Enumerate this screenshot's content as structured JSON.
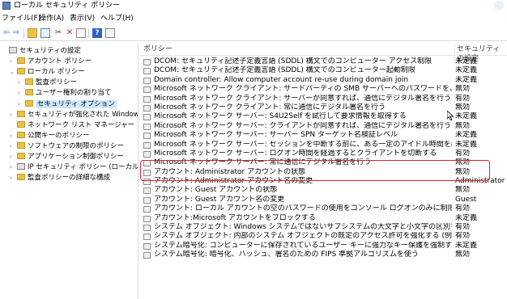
{
  "window": {
    "title": "ローカル セキュリティ ポリシー"
  },
  "menu": [
    "ファイル(F)",
    "操作(A)",
    "表示(V)",
    "ヘルプ(H)"
  ],
  "tree": [
    {
      "label": "セキュリティの設定",
      "level": 0,
      "arrow": "",
      "icon": "shield",
      "selected": false
    },
    {
      "label": "アカウント ポリシー",
      "level": 1,
      "arrow": "›",
      "icon": "folder",
      "selected": false
    },
    {
      "label": "ローカル ポリシー",
      "level": 1,
      "arrow": "⌄",
      "icon": "folder",
      "selected": false
    },
    {
      "label": "監査ポリシー",
      "level": 2,
      "arrow": "›",
      "icon": "folder",
      "selected": false
    },
    {
      "label": "ユーザー権利の割り当て",
      "level": 2,
      "arrow": "›",
      "icon": "folder",
      "selected": false
    },
    {
      "label": "セキュリティ オプション",
      "level": 2,
      "arrow": "›",
      "icon": "folder",
      "selected": true
    },
    {
      "label": "セキュリティが強化された Windows Defender",
      "level": 1,
      "arrow": "›",
      "icon": "folder",
      "selected": false
    },
    {
      "label": "ネットワーク リスト マネージャー ポリシー",
      "level": 1,
      "arrow": "",
      "icon": "folder",
      "selected": false
    },
    {
      "label": "公開キーのポリシー",
      "level": 1,
      "arrow": "›",
      "icon": "folder",
      "selected": false
    },
    {
      "label": "ソフトウェアの制限のポリシー",
      "level": 1,
      "arrow": "›",
      "icon": "folder",
      "selected": false
    },
    {
      "label": "アプリケーション制御ポリシー",
      "level": 1,
      "arrow": "›",
      "icon": "folder",
      "selected": false
    },
    {
      "label": "IP セキュリティ ポリシー (ローカル コンピュータ)",
      "level": 1,
      "arrow": "›",
      "icon": "shield",
      "selected": false
    },
    {
      "label": "監査ポリシーの詳細な構成",
      "level": 1,
      "arrow": "›",
      "icon": "folder",
      "selected": false
    }
  ],
  "list": {
    "col_policy": "ポリシー",
    "col_setting": "セキュリティの設定",
    "rows": [
      {
        "policy": "DCOM: セキュリティ記述子定義言語 (SDDL) 構文でのコンピューター アクセス制限",
        "setting": "未定義"
      },
      {
        "policy": "DCOM: セキュリティ記述子定義言語 (SDDL) 構文でのコンピューター起動制限",
        "setting": "未定義"
      },
      {
        "policy": "Domain controller: Allow computer account re-use during domain join",
        "setting": "未定義"
      },
      {
        "policy": "Microsoft ネットワーク クライアント: サードパーティの SMB サーバーへのパスワードを、暗号化しないで送信...",
        "setting": "無効"
      },
      {
        "policy": "Microsoft ネットワーク クライアント: サーバーが同意すれば、通信にデジタル署名を行う",
        "setting": "有効"
      },
      {
        "policy": "Microsoft ネットワーク クライアント: 常に通信にデジタル署名を行う",
        "setting": "無効"
      },
      {
        "policy": "Microsoft ネットワーク サーバー: S4U2Self を試行して要求情報を取得する",
        "setting": "未定義"
      },
      {
        "policy": "Microsoft ネットワーク サーバー: クライアントが同意すれば、通信にデジタル署名を行う",
        "setting": "無効"
      },
      {
        "policy": "Microsoft ネットワーク サーバー: サーバー SPN ターゲット名検証レベル",
        "setting": "未定義"
      },
      {
        "policy": "Microsoft ネットワーク サーバー: セッションを中断する前に、ある一定のアイドル時間を必要とする",
        "setting": "未定義"
      },
      {
        "policy": "Microsoft ネットワーク サーバー: ログオン時間を経過するとクライアントを切断する",
        "setting": "有効"
      },
      {
        "policy": "Microsoft ネットワーク サーバー: 常に通信にデジタル署名を行う",
        "setting": "無効"
      },
      {
        "policy": "アカウント: Administrator アカウントの状態",
        "setting": "無効"
      },
      {
        "policy": "アカウント: Administrator アカウント名の変更",
        "setting": "Administrator"
      },
      {
        "policy": "アカウント: Guest アカウントの状態",
        "setting": "無効"
      },
      {
        "policy": "アカウント: Guest アカウント名の変更",
        "setting": "Guest"
      },
      {
        "policy": "アカウント: ローカル アカウントの空のパスワードの使用をコンソール ログオンのみに制限する",
        "setting": "有効"
      },
      {
        "policy": "アカウント:Microsoft アカウントをブロックする",
        "setting": "未定義"
      },
      {
        "policy": "システム オブジェクト: Windows システムではないサブシステムの大文字と小文字の区別をしないことが...",
        "setting": "有効"
      },
      {
        "policy": "システム オブジェクト: 内部のシステム オブジェクトの既定のアクセス許可を強化する (例: シンボリック リンク)",
        "setting": "有効"
      },
      {
        "policy": "システム暗号化: コンピューターに保存されているユーザー キーに強力なキー保護を強制する",
        "setting": "未定義"
      },
      {
        "policy": "システム暗号化: 暗号化、ハッシュ、署名のための FIPS 準拠アルゴリズムを使う",
        "setting": "無効"
      }
    ]
  }
}
